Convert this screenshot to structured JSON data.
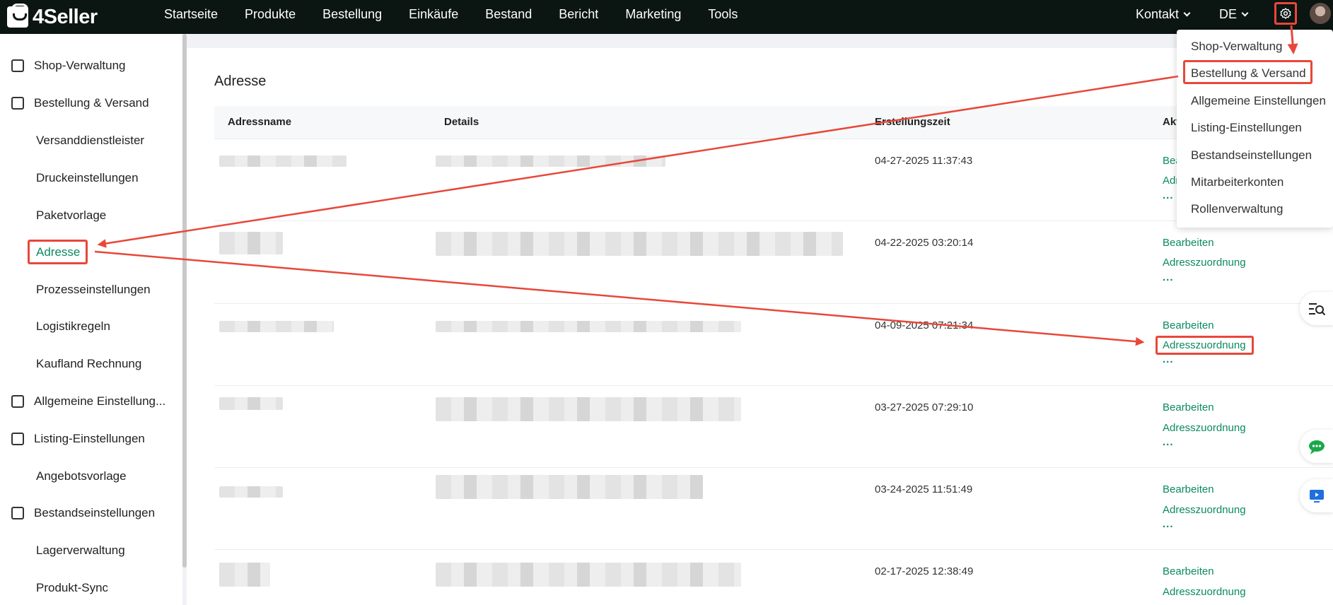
{
  "app": {
    "name": "4Seller"
  },
  "nav": {
    "items": [
      "Startseite",
      "Produkte",
      "Bestellung",
      "Einkäufe",
      "Bestand",
      "Bericht",
      "Marketing",
      "Tools"
    ],
    "contact": "Kontakt",
    "language": "DE"
  },
  "sidebar": {
    "items": [
      {
        "label": "Shop-Verwaltung",
        "level": "parent"
      },
      {
        "label": "Bestellung & Versand",
        "level": "parent"
      },
      {
        "label": "Versanddienstleister",
        "level": "child"
      },
      {
        "label": "Druckeinstellungen",
        "level": "child"
      },
      {
        "label": "Paketvorlage",
        "level": "child"
      },
      {
        "label": "Adresse",
        "level": "child",
        "active": true
      },
      {
        "label": "Prozesseinstellungen",
        "level": "child"
      },
      {
        "label": "Logistikregeln",
        "level": "child"
      },
      {
        "label": "Kaufland Rechnung",
        "level": "child"
      },
      {
        "label": "Allgemeine Einstellung...",
        "level": "parent"
      },
      {
        "label": "Listing-Einstellungen",
        "level": "parent"
      },
      {
        "label": "Angebotsvorlage",
        "level": "child"
      },
      {
        "label": "Bestandseinstellungen",
        "level": "parent"
      },
      {
        "label": "Lagerverwaltung",
        "level": "child"
      },
      {
        "label": "Produkt-Sync",
        "level": "child"
      }
    ]
  },
  "main": {
    "title": "Adresse",
    "columns": [
      "Adressname",
      "Details",
      "Erstellungszeit",
      "Akt"
    ],
    "rows": [
      {
        "time": "04-27-2025 11:37:43",
        "edit": "Bea",
        "assign": "Adr",
        "more": "..."
      },
      {
        "time": "04-22-2025 03:20:14",
        "edit": "Bearbeiten",
        "assign": "Adresszuordnung",
        "more": "..."
      },
      {
        "time": "04-09-2025 07:21:34",
        "edit": "Bearbeiten",
        "assign": "Adresszuordnung",
        "more": "..."
      },
      {
        "time": "03-27-2025 07:29:10",
        "edit": "Bearbeiten",
        "assign": "Adresszuordnung",
        "more": "..."
      },
      {
        "time": "03-24-2025 11:51:49",
        "edit": "Bearbeiten",
        "assign": "Adresszuordnung",
        "more": "..."
      },
      {
        "time": "02-17-2025 12:38:49",
        "edit": "Bearbeiten",
        "assign": "Adresszuordnung",
        "more": ""
      }
    ]
  },
  "settings_menu": {
    "items": [
      "Shop-Verwaltung",
      "Bestellung & Versand",
      "Allgemeine Einstellungen",
      "Listing-Einstellungen",
      "Bestandseinstellungen",
      "Mitarbeiterkonten",
      "Rollenverwaltung"
    ]
  },
  "colors": {
    "accent": "#0b8a5f",
    "highlight": "#e8473a",
    "topbar": "#0b1512"
  }
}
